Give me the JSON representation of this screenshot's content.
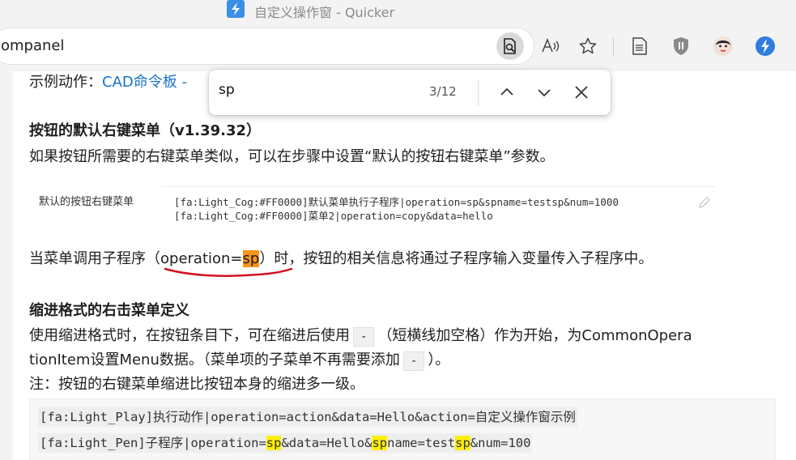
{
  "window": {
    "title": "自定义操作窗 - Quicker"
  },
  "address": {
    "url_fragment": "ompanel"
  },
  "find": {
    "query": "sp",
    "count": "3/12"
  },
  "content": {
    "example_prefix": "示例动作：",
    "example_link": "CAD命令板 -",
    "h1": "按钮的默认右键菜单（v1.39.32）",
    "p1": "如果按钮所需要的右键菜单类似，可以在步骤中设置“默认的按钮右键菜单”参数。",
    "settings_label": "默认的按钮右键菜单",
    "settings_line1": "[fa:Light_Cog:#FF0000]默认菜单执行子程序|operation=sp&spname=testsp&num=1000",
    "settings_line2": "[fa:Light_Cog:#FF0000]菜单2|operation=copy&data=hello",
    "p2_before": "当菜单调用子程序（operation=",
    "p2_hl": "sp",
    "p2_after": "）时，按钮的相关信息将通过子程序输入变量传入子程序中。",
    "h2": "缩进格式的右击菜单定义",
    "p3a_before": "使用缩进格式时，在按钮条目下，可在缩进后使用",
    "p3a_code": "-",
    "p3a_after": "（短横线加空格）作为开始，为CommonOpera",
    "p3b_before": "tionItem设置Menu数据。（菜单项的子菜单不再需要添加",
    "p3b_code": "-",
    "p3b_after": "）。",
    "p4": "注：按钮的右键菜单缩进比按钮本身的缩进多一级。",
    "code1": "[fa:Light_Play]执行动作|operation=action&data=Hello&action=自定义操作窗示例",
    "code2_a": "[fa:Light_Pen]子程序|operation=",
    "code2_b": "sp",
    "code2_c": "&data=Hello&",
    "code2_d": "sp",
    "code2_e": "name=test",
    "code2_f": "sp",
    "code2_g": "&num=100"
  },
  "colors": {
    "accent_link": "#1a73c8",
    "current_match": "#f7941e",
    "match": "#ffef00",
    "annotation": "#d4101e"
  }
}
